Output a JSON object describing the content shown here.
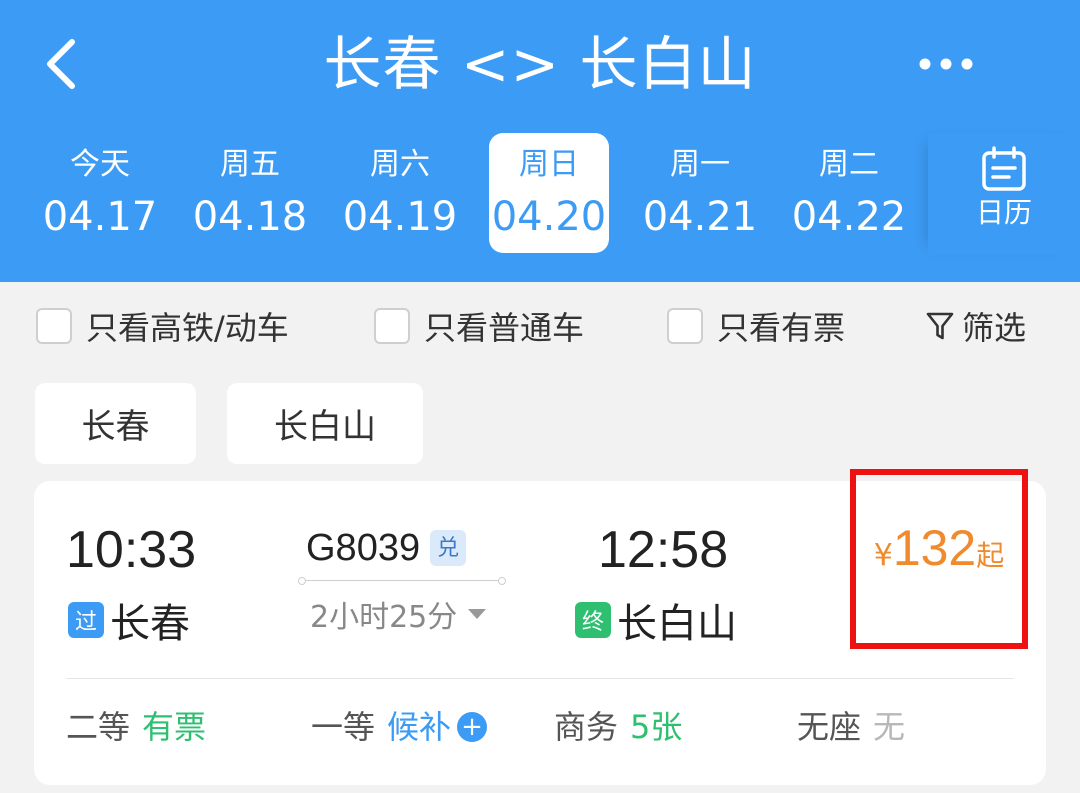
{
  "header": {
    "title": "长春 <> 长白山",
    "calendar_label": "日历"
  },
  "dates": [
    {
      "weekday": "今天",
      "date": "04.17",
      "selected": false
    },
    {
      "weekday": "周五",
      "date": "04.18",
      "selected": false
    },
    {
      "weekday": "周六",
      "date": "04.19",
      "selected": false
    },
    {
      "weekday": "周日",
      "date": "04.20",
      "selected": true
    },
    {
      "weekday": "周一",
      "date": "04.21",
      "selected": false
    },
    {
      "weekday": "周二",
      "date": "04.22",
      "selected": false
    }
  ],
  "filters": {
    "high_speed_only": "只看高铁/动车",
    "regular_only": "只看普通车",
    "available_only": "只看有票",
    "filter_button": "筛选"
  },
  "stations": {
    "from": "长春",
    "to": "长白山"
  },
  "train": {
    "departure_time": "10:33",
    "departure_tag": "过",
    "departure_station": "长春",
    "number": "G8039",
    "exchange_badge": "兑",
    "duration": "2小时25分",
    "arrival_time": "12:58",
    "arrival_tag": "终",
    "arrival_station": "长白山",
    "price_currency": "¥",
    "price_amount": "132",
    "price_suffix": "起",
    "seats": [
      {
        "name": "二等",
        "availability": "有票"
      },
      {
        "name": "一等",
        "availability": "候补"
      },
      {
        "name": "商务",
        "availability": "5张"
      },
      {
        "name": "无座",
        "availability": "无"
      }
    ]
  },
  "colors": {
    "primary": "#3c9bf4",
    "price": "#f08a2c",
    "available": "#2fbf71",
    "highlight_border": "#ee1111"
  }
}
